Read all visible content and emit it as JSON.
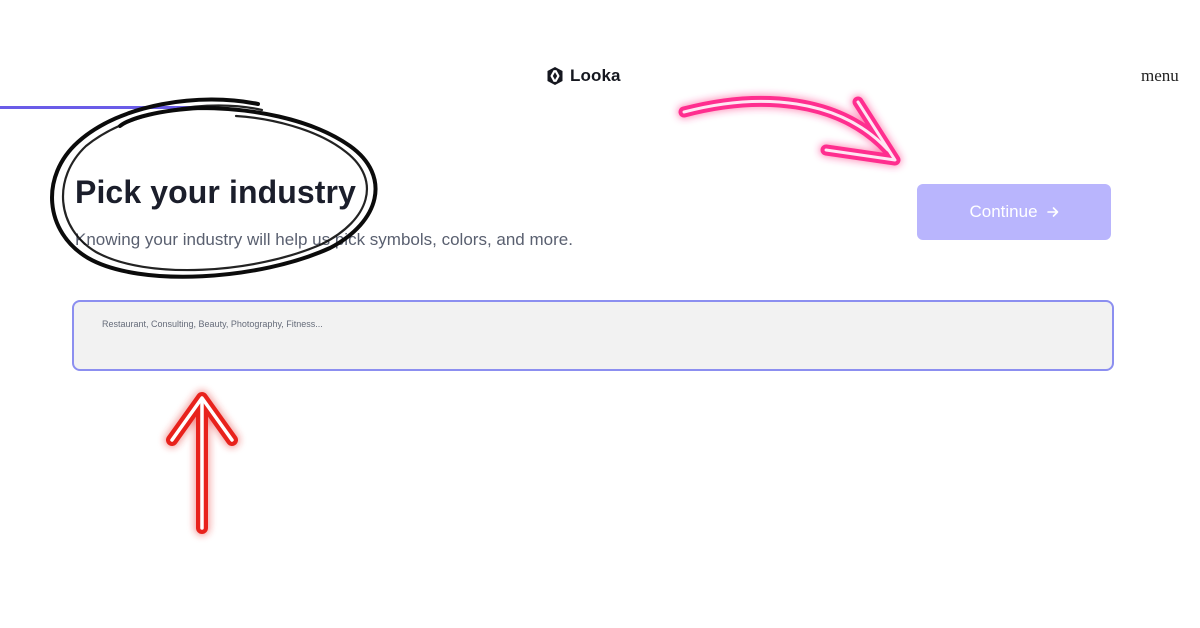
{
  "header": {
    "brand": "Looka",
    "menu_label": "menu"
  },
  "progress": {
    "fraction": 0.18,
    "color": "#6a5ce8"
  },
  "main": {
    "title": "Pick your industry",
    "subtitle": "Knowing your industry will help us pick symbols, colors, and more.",
    "continue_label": "Continue",
    "search": {
      "value": "",
      "placeholder": "Restaurant, Consulting, Beauty, Photography, Fitness..."
    }
  },
  "colors": {
    "accent": "#6a5ce8",
    "button_disabled": "#b9b5fd",
    "input_border": "#8c8ff0",
    "input_bg": "#f2f2f2",
    "annotation_pink": "#ff2d8f",
    "annotation_red": "#e8231c"
  },
  "icons": {
    "brand": "looka-logo-icon",
    "continue": "arrow-right-icon"
  }
}
